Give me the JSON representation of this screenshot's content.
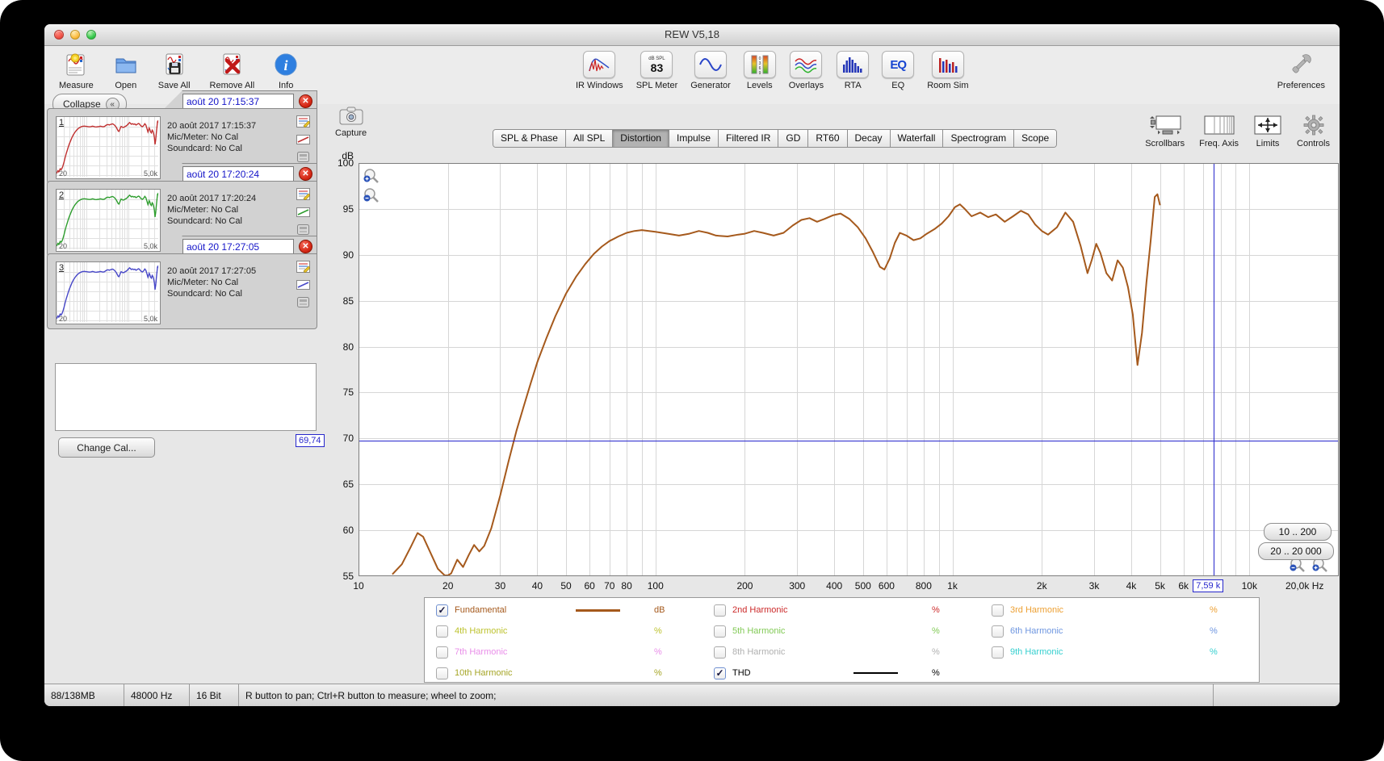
{
  "window_title": "REW V5,18",
  "toolbar": {
    "measure": "Measure",
    "open": "Open",
    "save_all": "Save All",
    "remove_all": "Remove All",
    "info": "Info",
    "ir_windows": "IR Windows",
    "spl_meter": "SPL Meter",
    "spl_meter_top": "dB SPL",
    "spl_meter_value": "83",
    "generator": "Generator",
    "levels": "Levels",
    "overlays": "Overlays",
    "rta": "RTA",
    "eq": "EQ",
    "room_sim": "Room Sim",
    "preferences": "Preferences"
  },
  "sidebar": {
    "collapse_label": "Collapse",
    "change_cal_label": "Change Cal...",
    "measurements": [
      {
        "index": "1",
        "name": "août 20 17:15:37",
        "date": "20 août 2017 17:15:37",
        "mic": "Mic/Meter: No Cal",
        "soundcard": "Soundcard: No Cal",
        "color": "#c03030",
        "thumb_min": "20",
        "thumb_max": "5,0k"
      },
      {
        "index": "2",
        "name": "août 20 17:20:24",
        "date": "20 août 2017 17:20:24",
        "mic": "Mic/Meter: No Cal",
        "soundcard": "Soundcard: No Cal",
        "color": "#2f9e2f",
        "thumb_min": "20",
        "thumb_max": "5,0k"
      },
      {
        "index": "3",
        "name": "août 20 17:27:05",
        "date": "20 août 2017 17:27:05",
        "mic": "Mic/Meter: No Cal",
        "soundcard": "Soundcard: No Cal",
        "color": "#4747c8",
        "thumb_min": "20",
        "thumb_max": "5,0k"
      }
    ]
  },
  "capture_label": "Capture",
  "tabs": [
    "SPL & Phase",
    "All SPL",
    "Distortion",
    "Impulse",
    "Filtered IR",
    "GD",
    "RT60",
    "Decay",
    "Waterfall",
    "Spectrogram",
    "Scope"
  ],
  "active_tab": "Distortion",
  "graph_buttons": {
    "scrollbars": "Scrollbars",
    "freq_axis": "Freq. Axis",
    "limits": "Limits",
    "controls": "Controls"
  },
  "range_buttons": {
    "top": "10 .. 200",
    "bottom": "20 .. 20 000"
  },
  "cursor": {
    "db_label": "69,74",
    "freq_label": "7,59 k",
    "db": 69.74,
    "freq_hz": 7590
  },
  "chart_data": {
    "type": "line",
    "x_scale": "log",
    "xlim": [
      10,
      20000
    ],
    "ylim": [
      55,
      100
    ],
    "ylabel": "dB",
    "x_unit": "Hz",
    "grid": true,
    "y_ticks": [
      100,
      95,
      90,
      85,
      80,
      75,
      70,
      65,
      60,
      55
    ],
    "x_gridlines": [
      10,
      20,
      30,
      40,
      50,
      60,
      70,
      80,
      90,
      100,
      200,
      300,
      400,
      500,
      600,
      700,
      800,
      900,
      1000,
      2000,
      3000,
      4000,
      5000,
      6000,
      7000,
      8000,
      9000,
      10000,
      20000
    ],
    "x_tick_labels": [
      {
        "f": 10,
        "t": "10"
      },
      {
        "f": 20,
        "t": "20"
      },
      {
        "f": 30,
        "t": "30"
      },
      {
        "f": 40,
        "t": "40"
      },
      {
        "f": 50,
        "t": "50"
      },
      {
        "f": 60,
        "t": "60"
      },
      {
        "f": 70,
        "t": "70"
      },
      {
        "f": 80,
        "t": "80"
      },
      {
        "f": 100,
        "t": "100"
      },
      {
        "f": 200,
        "t": "200"
      },
      {
        "f": 300,
        "t": "300"
      },
      {
        "f": 400,
        "t": "400"
      },
      {
        "f": 500,
        "t": "500"
      },
      {
        "f": 600,
        "t": "600"
      },
      {
        "f": 800,
        "t": "800"
      },
      {
        "f": 1000,
        "t": "1k"
      },
      {
        "f": 2000,
        "t": "2k"
      },
      {
        "f": 3000,
        "t": "3k"
      },
      {
        "f": 4000,
        "t": "4k"
      },
      {
        "f": 5000,
        "t": "5k"
      },
      {
        "f": 6000,
        "t": "6k"
      },
      {
        "f": 10000,
        "t": "10k"
      },
      {
        "f": 20000,
        "t": "20,0k Hz",
        "align": "right"
      }
    ],
    "series": [
      {
        "name": "Fundamental",
        "color": "#a5591c",
        "unit": "dB",
        "points": [
          [
            13,
            55.2
          ],
          [
            14,
            56.3
          ],
          [
            15,
            58.2
          ],
          [
            15.8,
            59.7
          ],
          [
            16.5,
            59.3
          ],
          [
            17.5,
            57.5
          ],
          [
            18.5,
            55.8
          ],
          [
            19.5,
            54.9
          ],
          [
            20,
            54.7
          ],
          [
            20.5,
            55.3
          ],
          [
            21.5,
            56.8
          ],
          [
            22.5,
            56.0
          ],
          [
            23.5,
            57.3
          ],
          [
            24.5,
            58.4
          ],
          [
            25.5,
            57.7
          ],
          [
            26.5,
            58.3
          ],
          [
            28,
            60.2
          ],
          [
            30,
            63.8
          ],
          [
            32,
            67.5
          ],
          [
            34,
            70.8
          ],
          [
            36,
            73.5
          ],
          [
            38,
            76.0
          ],
          [
            40,
            78.3
          ],
          [
            43,
            81.0
          ],
          [
            46,
            83.3
          ],
          [
            50,
            85.8
          ],
          [
            54,
            87.6
          ],
          [
            58,
            89.0
          ],
          [
            62,
            90.1
          ],
          [
            66,
            90.9
          ],
          [
            70,
            91.5
          ],
          [
            75,
            92.0
          ],
          [
            80,
            92.4
          ],
          [
            85,
            92.6
          ],
          [
            90,
            92.7
          ],
          [
            95,
            92.6
          ],
          [
            100,
            92.5
          ],
          [
            110,
            92.3
          ],
          [
            120,
            92.1
          ],
          [
            130,
            92.3
          ],
          [
            140,
            92.6
          ],
          [
            150,
            92.4
          ],
          [
            160,
            92.1
          ],
          [
            175,
            92.0
          ],
          [
            190,
            92.2
          ],
          [
            200,
            92.3
          ],
          [
            215,
            92.6
          ],
          [
            230,
            92.4
          ],
          [
            250,
            92.1
          ],
          [
            270,
            92.4
          ],
          [
            290,
            93.2
          ],
          [
            310,
            93.8
          ],
          [
            330,
            94.0
          ],
          [
            350,
            93.6
          ],
          [
            370,
            93.9
          ],
          [
            395,
            94.3
          ],
          [
            420,
            94.5
          ],
          [
            450,
            93.9
          ],
          [
            480,
            93.0
          ],
          [
            510,
            91.8
          ],
          [
            540,
            90.3
          ],
          [
            570,
            88.7
          ],
          [
            590,
            88.4
          ],
          [
            615,
            89.6
          ],
          [
            640,
            91.3
          ],
          [
            665,
            92.4
          ],
          [
            700,
            92.1
          ],
          [
            740,
            91.6
          ],
          [
            780,
            91.8
          ],
          [
            820,
            92.3
          ],
          [
            870,
            92.8
          ],
          [
            920,
            93.4
          ],
          [
            970,
            94.2
          ],
          [
            1020,
            95.2
          ],
          [
            1060,
            95.5
          ],
          [
            1100,
            95.0
          ],
          [
            1160,
            94.2
          ],
          [
            1240,
            94.6
          ],
          [
            1320,
            94.1
          ],
          [
            1400,
            94.4
          ],
          [
            1500,
            93.6
          ],
          [
            1600,
            94.2
          ],
          [
            1700,
            94.8
          ],
          [
            1800,
            94.4
          ],
          [
            1900,
            93.3
          ],
          [
            2000,
            92.6
          ],
          [
            2100,
            92.2
          ],
          [
            2250,
            93.0
          ],
          [
            2400,
            94.6
          ],
          [
            2550,
            93.6
          ],
          [
            2700,
            91.0
          ],
          [
            2850,
            88.0
          ],
          [
            2950,
            89.5
          ],
          [
            3050,
            91.2
          ],
          [
            3150,
            90.2
          ],
          [
            3300,
            88.0
          ],
          [
            3450,
            87.2
          ],
          [
            3600,
            89.4
          ],
          [
            3750,
            88.6
          ],
          [
            3900,
            86.5
          ],
          [
            4050,
            83.5
          ],
          [
            4200,
            78.0
          ],
          [
            4350,
            81.5
          ],
          [
            4500,
            87.0
          ],
          [
            4650,
            91.5
          ],
          [
            4800,
            96.3
          ],
          [
            4900,
            96.6
          ],
          [
            5000,
            95.4
          ]
        ]
      }
    ],
    "cursor": {
      "freq_hz": 7590,
      "db": 69.74
    }
  },
  "legend": {
    "items": [
      {
        "label": "Fundamental",
        "checked": true,
        "color": "#a5591c",
        "sample": true,
        "unit": "dB"
      },
      {
        "label": "2nd Harmonic",
        "checked": false,
        "color": "#cc2a2a",
        "sample": false,
        "unit": "%"
      },
      {
        "label": "3rd Harmonic",
        "checked": false,
        "color": "#eda033",
        "sample": false,
        "unit": "%"
      },
      {
        "label": "4th Harmonic",
        "checked": false,
        "color": "#bdc22e",
        "sample": false,
        "unit": "%"
      },
      {
        "label": "5th Harmonic",
        "checked": false,
        "color": "#82ca56",
        "sample": false,
        "unit": "%"
      },
      {
        "label": "6th Harmonic",
        "checked": false,
        "color": "#6e96e0",
        "sample": false,
        "unit": "%"
      },
      {
        "label": "7th Harmonic",
        "checked": false,
        "color": "#e98ee9",
        "sample": false,
        "unit": "%"
      },
      {
        "label": "8th Harmonic",
        "checked": false,
        "color": "#b0b0b0",
        "sample": false,
        "unit": "%"
      },
      {
        "label": "9th Harmonic",
        "checked": false,
        "color": "#35cfcf",
        "sample": false,
        "unit": "%"
      },
      {
        "label": "10th Harmonic",
        "checked": false,
        "color": "#a6a627",
        "sample": false,
        "unit": "%"
      },
      {
        "label": "THD",
        "checked": true,
        "color": "#000000",
        "sample": true,
        "unit": "%"
      }
    ]
  },
  "statusbar": {
    "memory": "88/138MB",
    "sample_rate": "48000 Hz",
    "bit_depth": "16 Bit",
    "hint": "R button to pan; Ctrl+R button to measure; wheel to zoom;"
  }
}
